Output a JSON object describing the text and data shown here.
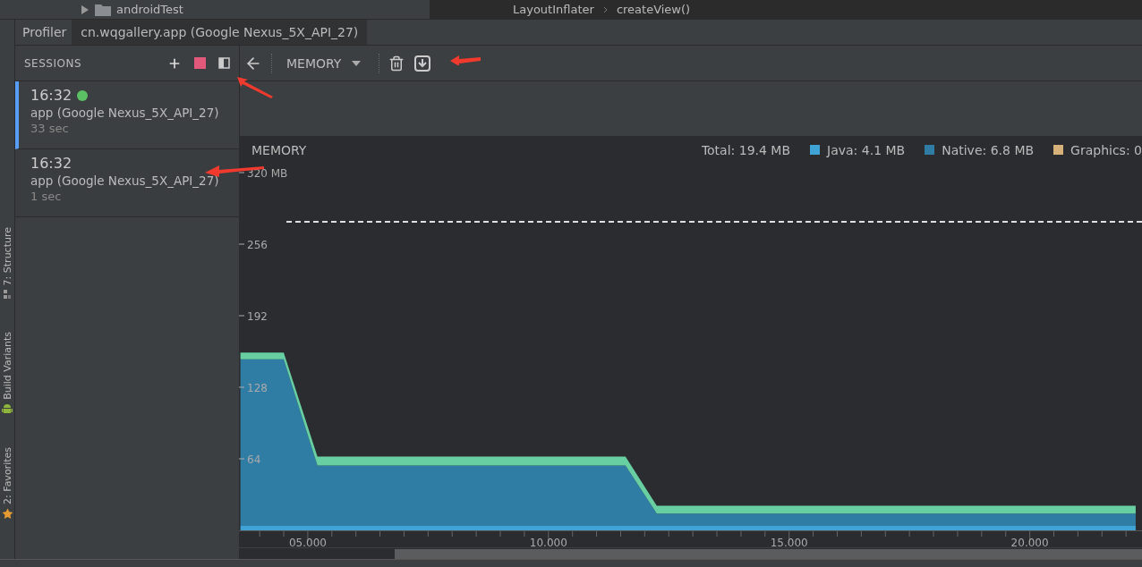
{
  "project_tree": {
    "items": [
      {
        "label": "androidTest",
        "expanded": false
      }
    ]
  },
  "breadcrumb": [
    "LayoutInflater",
    "createView()"
  ],
  "tool_strip": [
    {
      "label": "7: Structure",
      "kind": "structure"
    },
    {
      "label": "Build Variants",
      "kind": "android"
    },
    {
      "label": "2: Favorites",
      "kind": "star"
    }
  ],
  "tabs": {
    "title": "Profiler",
    "items": [
      {
        "label": "cn.wqgallery.app (Google Nexus_5X_API_27)",
        "selected": true
      }
    ]
  },
  "sessions": {
    "title": "SESSIONS",
    "items": [
      {
        "time": "16:32",
        "name": "app (Google Nexus_5X_API_27)",
        "duration": "33 sec",
        "selected": true,
        "live": true
      },
      {
        "time": "16:32",
        "name": "app (Google Nexus_5X_API_27)",
        "duration": "1 sec",
        "selected": false,
        "live": false
      }
    ]
  },
  "toolbar": {
    "monitor": "MEMORY"
  },
  "memory": {
    "title": "MEMORY",
    "total": "Total: 19.4 MB",
    "legend": [
      {
        "label": "Java: 4.1 MB",
        "color": "#3fa3d6"
      },
      {
        "label": "Native: 6.8 MB",
        "color": "#2f7ca5"
      },
      {
        "label": "Graphics: 0",
        "color": "#d6b27a"
      }
    ],
    "chart_data": {
      "type": "area",
      "stacked": true,
      "x": [
        3.6,
        4.5,
        5.2,
        11.6,
        12.25,
        22.2
      ],
      "series": [
        {
          "color": "#3fa3d6",
          "values": [
            4,
            4,
            4,
            4,
            4,
            4
          ]
        },
        {
          "color": "#2f7ca5",
          "values": [
            149,
            149,
            54,
            54,
            11,
            11
          ]
        },
        {
          "color": "#67cfa1",
          "values": [
            6,
            6,
            8,
            8,
            7,
            7
          ]
        }
      ],
      "xlim": [
        3.57,
        22.35
      ],
      "ylim": [
        0,
        352
      ],
      "xticks": [
        {
          "value": 5,
          "label": "05.000"
        },
        {
          "value": 10,
          "label": "10.000"
        },
        {
          "value": 15,
          "label": "15.000"
        },
        {
          "value": 20,
          "label": "20.000"
        }
      ],
      "yticks": [
        {
          "value": 64,
          "label": "64"
        },
        {
          "value": 128,
          "label": "128"
        },
        {
          "value": 192,
          "label": "192"
        },
        {
          "value": 256,
          "label": "256"
        },
        {
          "value": 320,
          "label": "320 MB"
        }
      ]
    }
  }
}
